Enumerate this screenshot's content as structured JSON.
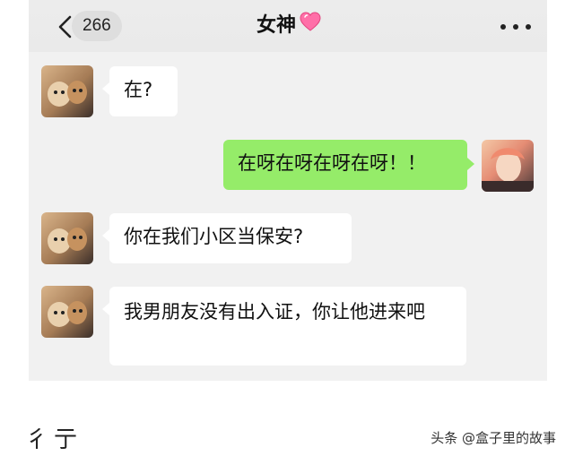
{
  "header": {
    "unread_count": "266",
    "title": "女神",
    "title_icon": "pink-heart-icon",
    "menu_icon": "more-dots-icon"
  },
  "messages": [
    {
      "from": "contact",
      "text": "在?"
    },
    {
      "from": "me",
      "text": "在呀在呀在呀在呀！！"
    },
    {
      "from": "contact",
      "text": "你在我们小区当保安?"
    },
    {
      "from": "contact",
      "text": "我男朋友没有出入证，你让他进来吧"
    }
  ],
  "footer": {
    "bottom_text": "彳亍",
    "watermark": "头条 @盒子里的故事"
  },
  "colors": {
    "chat_background": "#f1f1f1",
    "outgoing_bubble": "#95ec69",
    "incoming_bubble": "#ffffff"
  }
}
